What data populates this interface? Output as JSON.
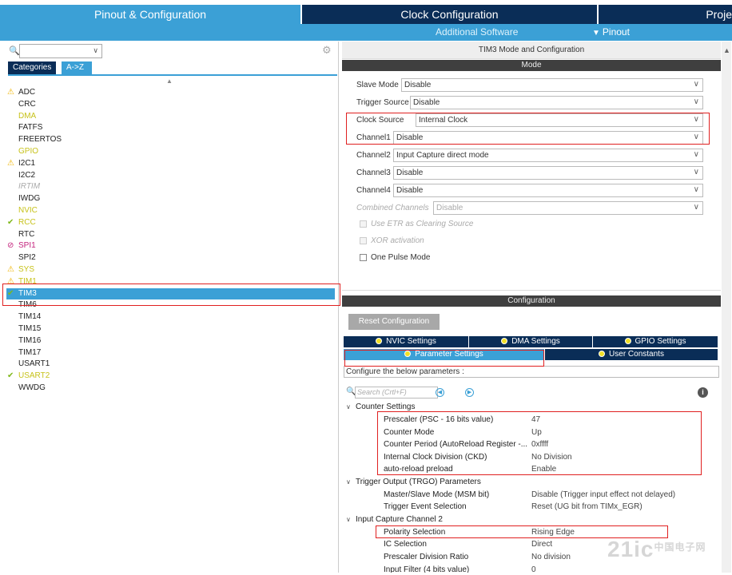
{
  "nav": {
    "tab_pinout": "Pinout & Configuration",
    "tab_clock": "Clock Configuration",
    "tab_project": "Proje",
    "sub_additional": "Additional Software",
    "sub_pinout": "Pinout"
  },
  "left": {
    "tab_categories": "Categories",
    "tab_az": "A->Z",
    "peripherals": [
      {
        "name": "ADC",
        "style": "normal",
        "marker": "warn"
      },
      {
        "name": "CRC",
        "style": "normal",
        "marker": ""
      },
      {
        "name": "DMA",
        "style": "yellow",
        "marker": ""
      },
      {
        "name": "FATFS",
        "style": "normal",
        "marker": ""
      },
      {
        "name": "FREERTOS",
        "style": "normal",
        "marker": ""
      },
      {
        "name": "GPIO",
        "style": "yellow",
        "marker": ""
      },
      {
        "name": "I2C1",
        "style": "normal",
        "marker": "warn"
      },
      {
        "name": "I2C2",
        "style": "normal",
        "marker": ""
      },
      {
        "name": "IRTIM",
        "style": "italic",
        "marker": ""
      },
      {
        "name": "IWDG",
        "style": "normal",
        "marker": ""
      },
      {
        "name": "NVIC",
        "style": "yellow",
        "marker": ""
      },
      {
        "name": "RCC",
        "style": "yellow",
        "marker": "check"
      },
      {
        "name": "RTC",
        "style": "normal",
        "marker": ""
      },
      {
        "name": "SPI1",
        "style": "pink",
        "marker": "ban"
      },
      {
        "name": "SPI2",
        "style": "normal",
        "marker": ""
      },
      {
        "name": "SYS",
        "style": "yellow",
        "marker": "warn"
      },
      {
        "name": "TIM1",
        "style": "yellow",
        "marker": "warn"
      },
      {
        "name": "TIM3",
        "style": "sel",
        "marker": "check"
      },
      {
        "name": "TIM6",
        "style": "normal",
        "marker": ""
      },
      {
        "name": "TIM14",
        "style": "normal",
        "marker": ""
      },
      {
        "name": "TIM15",
        "style": "normal",
        "marker": ""
      },
      {
        "name": "TIM16",
        "style": "normal",
        "marker": ""
      },
      {
        "name": "TIM17",
        "style": "normal",
        "marker": ""
      },
      {
        "name": "USART1",
        "style": "normal",
        "marker": ""
      },
      {
        "name": "USART2",
        "style": "yellow",
        "marker": "check"
      },
      {
        "name": "WWDG",
        "style": "normal",
        "marker": ""
      }
    ]
  },
  "right": {
    "title": "TIM3 Mode and Configuration",
    "mode_header": "Mode",
    "mode_rows": [
      {
        "label": "Slave Mode",
        "value": "Disable"
      },
      {
        "label": "Trigger Source",
        "value": "Disable"
      },
      {
        "label": "Clock Source",
        "value": "Internal Clock"
      },
      {
        "label": "Channel1",
        "value": "Disable"
      },
      {
        "label": "Channel2",
        "value": "Input Capture direct mode"
      },
      {
        "label": "Channel3",
        "value": "Disable"
      },
      {
        "label": "Channel4",
        "value": "Disable"
      },
      {
        "label": "Combined Channels",
        "value": "Disable"
      }
    ],
    "checkboxes": [
      {
        "label": "Use ETR as Clearing Source"
      },
      {
        "label": "XOR activation"
      },
      {
        "label": "One Pulse Mode"
      }
    ],
    "config_header": "Configuration",
    "reset_button": "Reset Configuration",
    "tabs": {
      "nvic": "NVIC Settings",
      "dma": "DMA Settings",
      "gpio": "GPIO Settings",
      "parameter": "Parameter Settings",
      "user_constants": "User Constants"
    },
    "configure_note": "Configure the below parameters :",
    "search_placeholder": "Search (Crtl+F)",
    "groups": {
      "counter": "Counter Settings",
      "trgo": "Trigger Output (TRGO) Parameters",
      "ic2": "Input Capture Channel 2"
    },
    "params": {
      "prescaler": {
        "label": "Prescaler (PSC - 16 bits value)",
        "value": "47"
      },
      "counter_mode": {
        "label": "Counter Mode",
        "value": "Up"
      },
      "counter_period": {
        "label": "Counter Period (AutoReload Register -...",
        "value": "0xffff"
      },
      "ckd": {
        "label": "Internal Clock Division (CKD)",
        "value": "No Division"
      },
      "autoreload": {
        "label": "auto-reload preload",
        "value": "Enable"
      },
      "msm": {
        "label": "Master/Slave Mode (MSM bit)",
        "value": "Disable (Trigger input effect not delayed)"
      },
      "trigger_event": {
        "label": "Trigger Event Selection",
        "value": "Reset (UG bit from TIMx_EGR)"
      },
      "polarity": {
        "label": "Polarity Selection",
        "value": "Rising Edge"
      },
      "ic_selection": {
        "label": "IC Selection",
        "value": "Direct"
      },
      "prescaler_ratio": {
        "label": "Prescaler Division Ratio",
        "value": "No division"
      },
      "input_filter": {
        "label": "Input Filter (4 bits value)",
        "value": "0"
      }
    }
  },
  "watermark": {
    "main": "21ic",
    "sub": "中国电子网"
  },
  "colors": {
    "accent": "#3ba0d6",
    "navy": "#0a2d57",
    "highlight": "#e02020",
    "warn": "#f0b400",
    "ok": "#7fb81b"
  }
}
